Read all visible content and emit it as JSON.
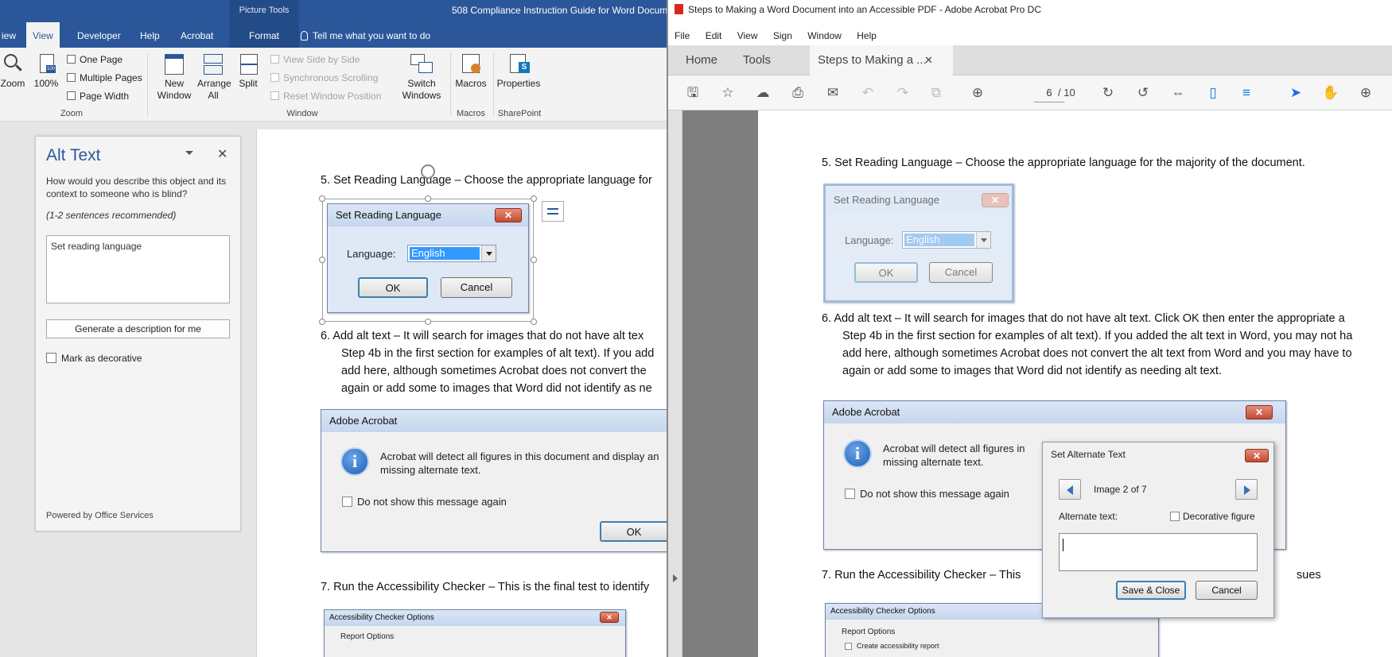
{
  "word": {
    "doc_title": "508 Compliance Instruction Guide for Word Docum",
    "picture_tools": "Picture Tools",
    "tabs": [
      "iew",
      "View",
      "Developer",
      "Help",
      "Acrobat",
      "Format"
    ],
    "tell_me": "Tell me what you want to do",
    "ribbon": {
      "zoom_label": "Zoom",
      "zoom100_label": "100%",
      "one_page": "One Page",
      "multiple_pages": "Multiple Pages",
      "page_width": "Page Width",
      "zoom_group": "Zoom",
      "new_window": "New Window",
      "arrange_all": "Arrange All",
      "split": "Split",
      "view_side_by_side": "View Side by Side",
      "sync_scrolling": "Synchronous Scrolling",
      "reset_window": "Reset Window Position",
      "switch_windows": "Switch Windows",
      "window_group": "Window",
      "macros": "Macros",
      "macros_group": "Macros",
      "properties": "Properties",
      "sharepoint_group": "SharePoint"
    },
    "alt_pane": {
      "title": "Alt Text",
      "question": "How would you describe this object and its context to someone who is blind?",
      "recommended": "(1-2 sentences recommended)",
      "value": "Set reading language",
      "generate_button": "Generate a description for me",
      "decorative_label": "Mark as decorative",
      "powered_by": "Powered by Office Services",
      "close": "✕"
    },
    "page": {
      "step5": "5.   Set Reading Language – Choose the appropriate language for",
      "step6_l1": "6.   Add alt text – It will search for images that do not have alt tex",
      "step6_l2": "Step 4b in the first section for examples of alt text). If you add",
      "step6_l3": "add here, although sometimes Acrobat does not convert the",
      "step6_l4": "again or add some to images that Word did not identify as ne",
      "step7": "7.   Run the Accessibility Checker – This is the final test to identify",
      "reading_dlg": {
        "title": "Set Reading Language",
        "language_label": "Language:",
        "language_value": "English",
        "ok": "OK",
        "cancel": "Cancel"
      },
      "acrobat_dlg": {
        "title": "Adobe Acrobat",
        "message_l1": "Acrobat will detect all figures in this document and display an",
        "message_l2": "missing alternate text.",
        "dont_show": "Do not show this message again",
        "ok": "OK"
      },
      "checker_dlg": {
        "title": "Accessibility Checker Options",
        "report_options": "Report Options"
      }
    }
  },
  "acrobat": {
    "title": "Steps to Making a Word Document into an Accessible PDF - Adobe Acrobat Pro DC",
    "menu": [
      "File",
      "Edit",
      "View",
      "Sign",
      "Window",
      "Help"
    ],
    "tabs": {
      "home": "Home",
      "tools": "Tools",
      "doc": "Steps to Making a ...",
      "close": "✕"
    },
    "page_current": "6",
    "page_total": "/ 10",
    "page": {
      "step5": "5.   Set Reading Language – Choose the appropriate language for the majority of the document.",
      "step6_l1": "6.   Add alt text – It will search for images that do not have alt text. Click OK then enter the appropriate a",
      "step6_l2": "Step 4b in the first section for examples of alt text). If you added the alt text in Word, you may not ha",
      "step6_l3": "add here, although sometimes Acrobat does not convert the alt text from Word and you may have to",
      "step6_l4": "again or add some to images that Word did not identify as needing alt text.",
      "step7": "7.   Run the Accessibility Checker – This",
      "step7_tail": "sues",
      "reading_dlg": {
        "title": "Set Reading Language",
        "language_label": "Language:",
        "language_value": "English",
        "ok": "OK",
        "cancel": "Cancel"
      },
      "acrobat_dlg": {
        "title": "Adobe Acrobat",
        "message_l1": "Acrobat will detect all figures in",
        "message_l2": "missing alternate text.",
        "dont_show": "Do not show this message again"
      },
      "checker_dlg": {
        "title": "Accessibility Checker Options",
        "report_options": "Report Options",
        "create_report": "Create accessibility report"
      }
    },
    "alt_dialog": {
      "title": "Set Alternate Text",
      "counter": "Image 2 of 7",
      "alt_label": "Alternate text:",
      "decorative": "Decorative figure",
      "save_close": "Save & Close",
      "cancel": "Cancel"
    }
  }
}
